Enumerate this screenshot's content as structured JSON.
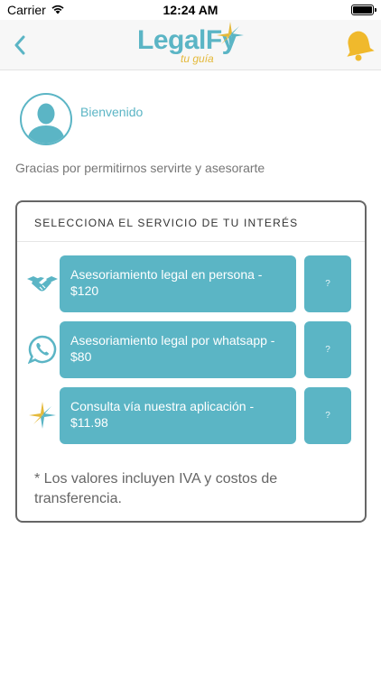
{
  "status_bar": {
    "carrier": "Carrier",
    "time": "12:24 AM"
  },
  "nav": {
    "logo_main": "LegalFy",
    "logo_sub": "tu guía",
    "icons": {
      "back": "chevron-left-icon",
      "bell": "bell-icon"
    }
  },
  "profile": {
    "welcome": "Bienvenido",
    "thanks": "Gracias por permitirnos servirte y asesorarte"
  },
  "services": {
    "title": "SELECCIONA EL SERVICIO DE TU INTERÉS",
    "items": [
      {
        "label": "Asesoriamiento legal en persona - $120",
        "help": "?",
        "icon": "handshake-icon"
      },
      {
        "label": "Asesoriamiento legal por whatsapp - $80",
        "help": "?",
        "icon": "whatsapp-icon"
      },
      {
        "label": "Consulta vía nuestra aplicación - $11.98",
        "help": "?",
        "icon": "star-logo-icon"
      }
    ],
    "footnote": "* Los valores incluyen IVA y costos de transferencia."
  },
  "colors": {
    "accent": "#5bb5c5",
    "gold": "#e4b93a",
    "border": "#666666"
  }
}
